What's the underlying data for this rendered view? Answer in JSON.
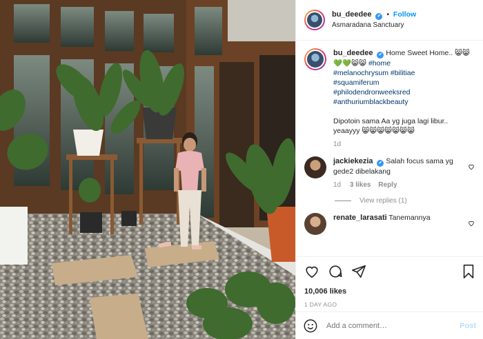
{
  "header": {
    "username": "bu_deedee",
    "verified_mark": "✔",
    "separator": "•",
    "follow_label": "Follow",
    "location": "Asmaradana Sanctuary"
  },
  "caption": {
    "username": "bu_deedee",
    "text_lead": "Home Sweet Home.. 😸😸💚💚😸😸",
    "hashtags": [
      "#home",
      "#melanochrysum",
      "#bilitiae",
      "#squamiferum",
      "#philodendronweeksred",
      "#anthuriumblackbeauty"
    ],
    "text_tail": "Dipotoin sama Aa yg juga lagi libur.. yeaayyy 😸😸😸😸😸😸😸",
    "age": "1d"
  },
  "comments": [
    {
      "username": "jackiekezia",
      "text": "Salah focus sama yg gede2 dibelakang",
      "age": "1d",
      "likes": "3 likes",
      "reply_label": "Reply",
      "view_replies": "View replies (1)"
    },
    {
      "username": "renate_larasati",
      "text": "Tanemannya"
    }
  ],
  "actions": {
    "likes": "10,006 likes",
    "timestamp": "1 DAY AGO"
  },
  "add_comment": {
    "placeholder": "Add a comment…",
    "post_label": "Post"
  },
  "colors": {
    "link_blue": "#0095f6",
    "hashtag": "#00376b",
    "muted": "#8e8e8e"
  }
}
